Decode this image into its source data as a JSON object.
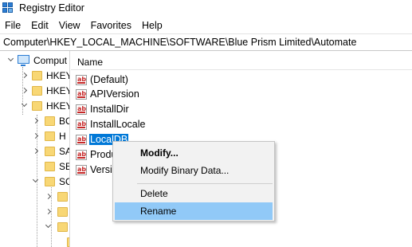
{
  "window": {
    "title": "Registry Editor"
  },
  "menubar": {
    "items": [
      "File",
      "Edit",
      "View",
      "Favorites",
      "Help"
    ]
  },
  "address": {
    "path": "Computer\\HKEY_LOCAL_MACHINE\\SOFTWARE\\Blue Prism Limited\\Automate"
  },
  "tree": {
    "computer_label": "Comput",
    "hkey1": "HKEY",
    "hkey2": "HKEY",
    "hkey3": "HKEY",
    "child_bc": "BC",
    "child_h": "H",
    "child_sa": "SA",
    "child_se": "SE",
    "child_sc": "SC"
  },
  "list": {
    "column_name": "Name",
    "values": [
      "(Default)",
      "APIVersion",
      "InstallDir",
      "InstallLocale",
      "LocalDB",
      "Produ",
      "Versio"
    ],
    "selected_index": 4
  },
  "context_menu": {
    "modify": "Modify...",
    "modify_binary": "Modify Binary Data...",
    "delete": "Delete",
    "rename": "Rename"
  },
  "icons": {
    "app": "registry-editor-icon",
    "value": "string-value-icon",
    "folder": "folder-icon",
    "computer": "computer-icon"
  },
  "colors": {
    "selection": "#0078d7",
    "menu_highlight": "#91c9f7",
    "folder": "#f8d775"
  }
}
